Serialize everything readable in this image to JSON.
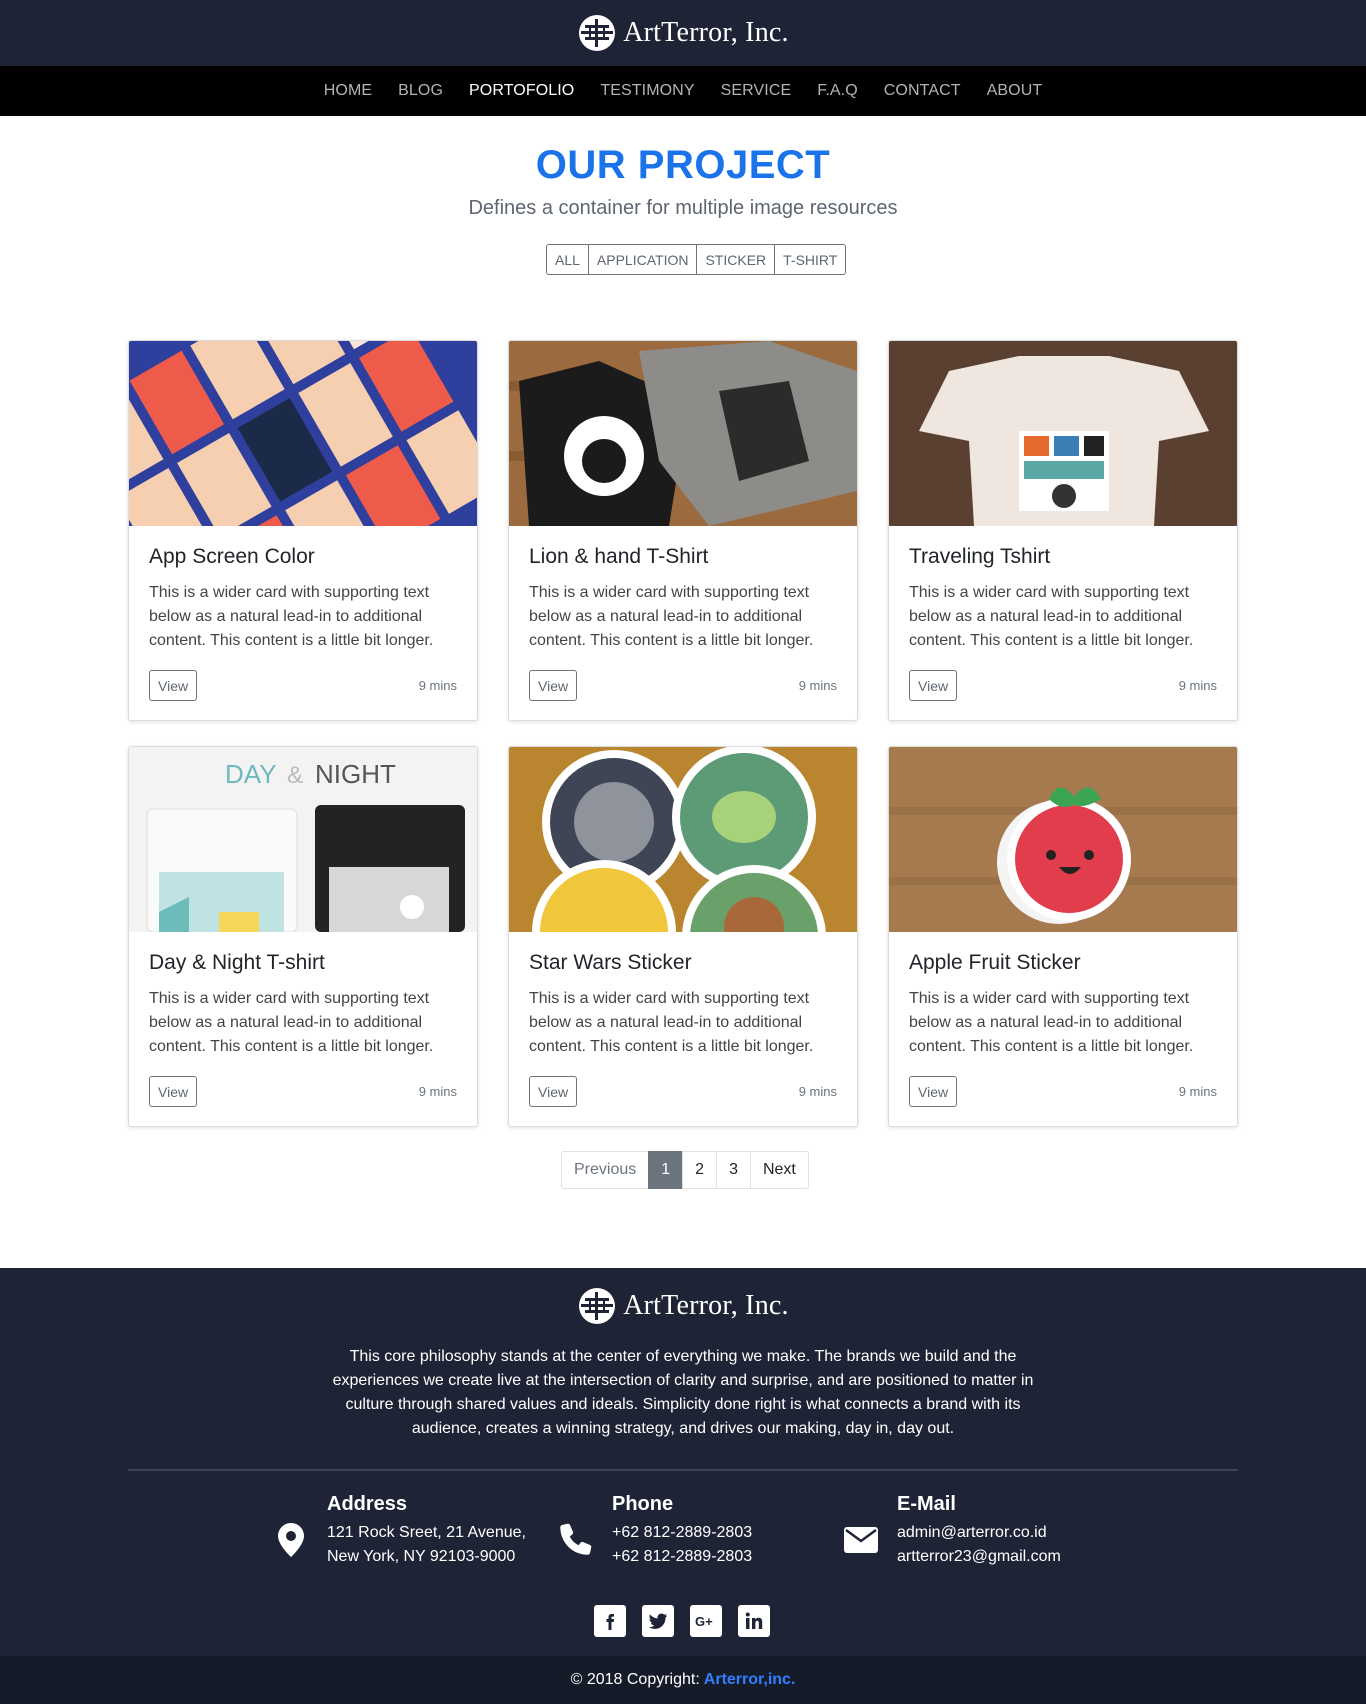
{
  "brand": {
    "name": "ArtTerror, Inc."
  },
  "nav": {
    "items": [
      {
        "label": "HOME",
        "active": false
      },
      {
        "label": "BLOG",
        "active": false
      },
      {
        "label": "PORTOFOLIO",
        "active": true
      },
      {
        "label": "TESTIMONY",
        "active": false
      },
      {
        "label": "SERVICE",
        "active": false
      },
      {
        "label": "F.A.Q",
        "active": false
      },
      {
        "label": "CONTACT",
        "active": false
      },
      {
        "label": "ABOUT",
        "active": false
      }
    ]
  },
  "project": {
    "title": "OUR PROJECT",
    "subtitle": "Defines a container for multiple image resources",
    "filters": [
      "ALL",
      "APPLICATION",
      "STICKER",
      "T-SHIRT"
    ]
  },
  "cards": [
    {
      "title": "App Screen Color",
      "text": "This is a wider card with supporting text below as a natural lead-in to additional content. This content is a little bit longer.",
      "button": "View",
      "meta": "9 mins"
    },
    {
      "title": "Lion & hand T-Shirt",
      "text": "This is a wider card with supporting text below as a natural lead-in to additional content. This content is a little bit longer.",
      "button": "View",
      "meta": "9 mins"
    },
    {
      "title": "Traveling Tshirt",
      "text": "This is a wider card with supporting text below as a natural lead-in to additional content. This content is a little bit longer.",
      "button": "View",
      "meta": "9 mins"
    },
    {
      "title": "Day & Night T-shirt",
      "image_caption_left": "DAY",
      "image_caption_amp": "&",
      "image_caption_right": "NIGHT",
      "text": "This is a wider card with supporting text below as a natural lead-in to additional content. This content is a little bit longer.",
      "button": "View",
      "meta": "9 mins"
    },
    {
      "title": "Star Wars Sticker",
      "text": "This is a wider card with supporting text below as a natural lead-in to additional content. This content is a little bit longer.",
      "button": "View",
      "meta": "9 mins"
    },
    {
      "title": "Apple Fruit Sticker",
      "text": "This is a wider card with supporting text below as a natural lead-in to additional content. This content is a little bit longer.",
      "button": "View",
      "meta": "9 mins"
    }
  ],
  "pagination": {
    "previous": "Previous",
    "pages": [
      "1",
      "2",
      "3"
    ],
    "current": "1",
    "next": "Next"
  },
  "footer": {
    "text": "This core philosophy stands at the center of everything we make. The brands we build and the experiences we create live at the intersection of clarity and surprise, and are positioned to matter in culture through shared values and ideals. Simplicity done right is what connects a brand with its audience, creates a winning strategy, and drives our making, day in, day out.",
    "address": {
      "heading": "Address",
      "line1": "121 Rock Sreet, 21 Avenue,",
      "line2": "New York, NY 92103-9000"
    },
    "phone": {
      "heading": "Phone",
      "line1": "+62 812-2889-2803",
      "line2": "+62 812-2889-2803"
    },
    "email": {
      "heading": "E-Mail",
      "line1": "admin@arterror.co.id",
      "line2": "artterror23@gmail.com"
    },
    "socials": [
      "facebook-icon",
      "twitter-icon",
      "google-plus-icon",
      "linkedin-icon"
    ],
    "copyright_prefix": "© 2018 Copyright:",
    "copyright_link": "Arterror,inc."
  },
  "colors": {
    "header_bg": "#1e2436",
    "nav_bg": "#000000",
    "accent": "#1a73e8",
    "link": "#2f80ff"
  }
}
